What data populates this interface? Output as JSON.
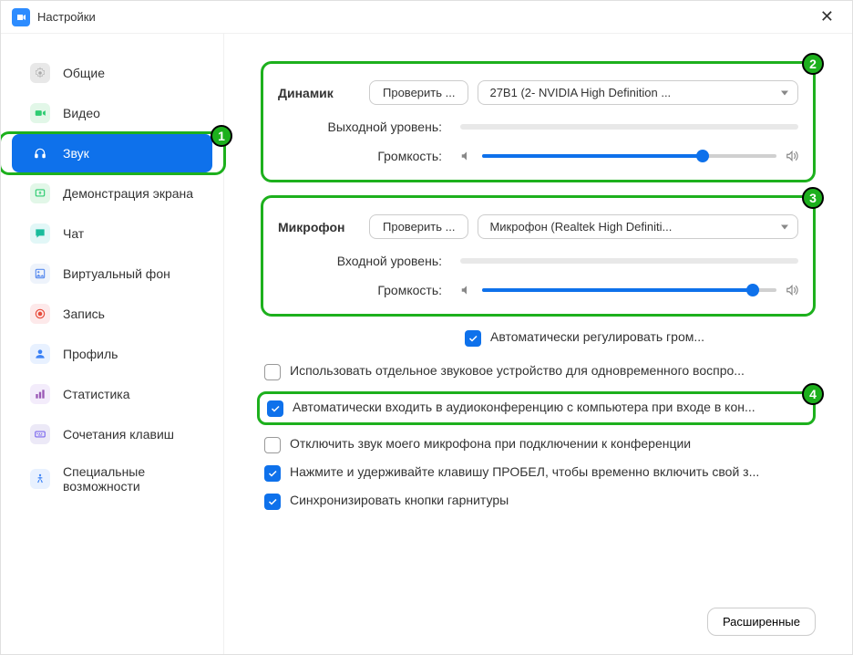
{
  "title": "Настройки",
  "sidebar": {
    "items": [
      {
        "label": "Общие",
        "icon": "gear",
        "bg": "#e8e8e8",
        "fg": "#aaa"
      },
      {
        "label": "Видео",
        "icon": "video",
        "bg": "#e2f7e8",
        "fg": "#2ecc71"
      },
      {
        "label": "Звук",
        "icon": "headphones",
        "bg": "#fff",
        "fg": "#fff",
        "active": true
      },
      {
        "label": "Демонстрация экрана",
        "icon": "share",
        "bg": "#e2f7e8",
        "fg": "#2ecc71"
      },
      {
        "label": "Чат",
        "icon": "chat",
        "bg": "#e2f7f7",
        "fg": "#1abc9c"
      },
      {
        "label": "Виртуальный фон",
        "icon": "bg",
        "bg": "#eef3fb",
        "fg": "#5b8def"
      },
      {
        "label": "Запись",
        "icon": "record",
        "bg": "#fde9ea",
        "fg": "#e74c3c"
      },
      {
        "label": "Профиль",
        "icon": "profile",
        "bg": "#e8f1ff",
        "fg": "#3b82f6"
      },
      {
        "label": "Статистика",
        "icon": "stats",
        "bg": "#f3ecfb",
        "fg": "#9b59b6"
      },
      {
        "label": "Сочетания клавиш",
        "icon": "keyboard",
        "bg": "#ece9f7",
        "fg": "#7b68ee"
      },
      {
        "label": "Специальные возможности",
        "icon": "access",
        "bg": "#e8f1ff",
        "fg": "#3b82f6"
      }
    ]
  },
  "speaker": {
    "title": "Динамик",
    "test": "Проверить ...",
    "device": "27B1 (2- NVIDIA High Definition ...",
    "output_level_label": "Выходной уровень:",
    "volume_label": "Громкость:",
    "volume_pct": 75
  },
  "mic": {
    "title": "Микрофон",
    "test": "Проверить ...",
    "device": "Микрофон (Realtek High Definiti...",
    "input_level_label": "Входной уровень:",
    "volume_label": "Громкость:",
    "volume_pct": 92,
    "auto_adjust": "Автоматически регулировать гром..."
  },
  "options": {
    "separate_device": "Использовать отдельное звуковое устройство для одновременного воспро...",
    "auto_join": "Автоматически входить в аудиоконференцию с компьютера при входе в кон...",
    "mute_on_join": "Отключить звук моего микрофона при подключении к конференции",
    "space_unmute": "Нажмите и удерживайте клавишу ПРОБЕЛ, чтобы временно включить свой з...",
    "sync_headset": "Синхронизировать кнопки гарнитуры"
  },
  "advanced": "Расширенные",
  "badges": {
    "b1": "1",
    "b2": "2",
    "b3": "3",
    "b4": "4"
  }
}
